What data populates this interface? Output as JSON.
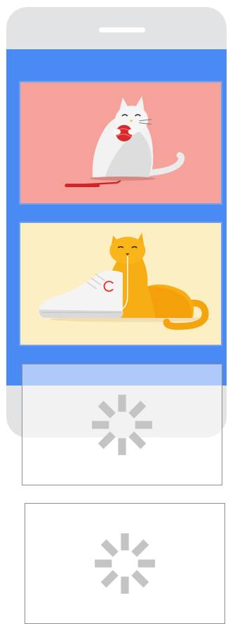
{
  "device": {
    "frame_color": "#e2e3e5",
    "screen_color": "#4a8af4"
  },
  "cards": [
    {
      "illustration": "white-cat-with-red-yarn",
      "background": "#f4a29a"
    },
    {
      "illustration": "orange-cat-with-white-sneaker",
      "background": "#fcefc4"
    }
  ],
  "placeholders": [
    {
      "state": "loading",
      "icon": "loading-spinner-icon"
    },
    {
      "state": "loading",
      "icon": "loading-spinner-icon"
    }
  ]
}
